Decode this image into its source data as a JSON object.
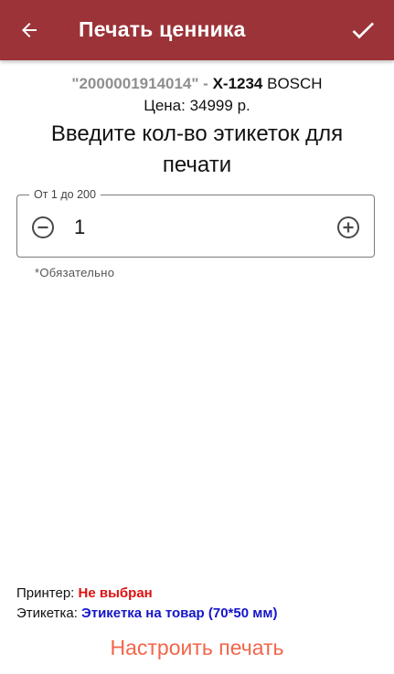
{
  "toolbar": {
    "title": "Печать ценника",
    "back_icon": "arrow-left-icon",
    "confirm_icon": "check-icon"
  },
  "product": {
    "barcode": "\"2000001914014\"",
    "separator": " - ",
    "article": "X-1234",
    "brand": " BOSCH",
    "price": "Цена: 34999 р."
  },
  "prompt": "Введите кол-во этикеток для печати",
  "quantity": {
    "legend": "От 1 до 200",
    "value": "1",
    "minus_icon": "minus-circle-icon",
    "plus_icon": "plus-circle-icon"
  },
  "required_hint": "*Обязательно",
  "printer": {
    "label": "Принтер: ",
    "value": "Не выбран",
    "value_color": "#e01010"
  },
  "label": {
    "label": "Этикетка: ",
    "value": "Этикетка на товар (70*50 мм)",
    "value_color": "#1515c8"
  },
  "setup_button": "Настроить печать",
  "colors": {
    "appbar": "#9b3338",
    "accent": "#f2654a"
  }
}
